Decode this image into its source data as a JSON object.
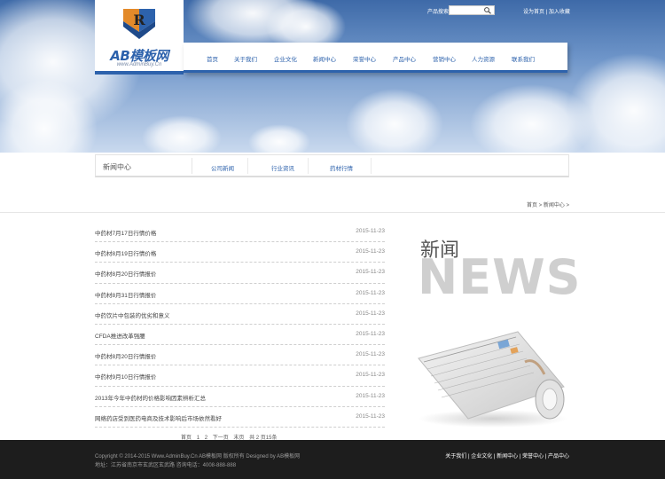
{
  "header": {
    "logo_letter": "R",
    "logo_text": "AB模板网",
    "logo_url": "www.AdminBuy.Cn",
    "search_label": "产品搜索",
    "search_placeholder": "",
    "top_links": [
      "设为首页",
      "加入收藏"
    ],
    "nav": [
      "首页",
      "关于我们",
      "企业文化",
      "新闻中心",
      "荣誉中心",
      "产品中心",
      "营销中心",
      "人力资源",
      "联系我们"
    ]
  },
  "subnav": {
    "section_title": "新闻中心",
    "tabs": [
      "公司新闻",
      "行业资讯",
      "药材行情"
    ]
  },
  "breadcrumb": "首页 > 新闻中心 >",
  "news": [
    {
      "title": "中药材7月17日行情价格",
      "date": "2015-11-23"
    },
    {
      "title": "中药材8月19日行情价格",
      "date": "2015-11-23"
    },
    {
      "title": "中药材8月20日行情报价",
      "date": "2015-11-23"
    },
    {
      "title": "中药材8月31日行情报价",
      "date": "2015-11-23"
    },
    {
      "title": "中药饮片中包装的优劣和意义",
      "date": "2015-11-23"
    },
    {
      "title": "CFDA推进改革强腰",
      "date": "2015-11-23"
    },
    {
      "title": "中药材8月20日行情报价",
      "date": "2015-11-23"
    },
    {
      "title": "中药材9月10日行情报价",
      "date": "2015-11-23"
    },
    {
      "title": "2013年今年中药材的价格影响因素辨析汇总",
      "date": "2015-11-23"
    },
    {
      "title": "网络药店受到医药电商及技术影响后市场依然看好",
      "date": "2015-11-23"
    }
  ],
  "pager": {
    "text": "首页 1 2 下一页 末页 共 2 页15条",
    "items": [
      "首页",
      "1",
      "2",
      "下一页",
      "末页"
    ],
    "summary": "共 2 页15条"
  },
  "side": {
    "title_cn": "新闻",
    "title_en": "NEWS"
  },
  "footer": {
    "copyright": "Copyright © 2014-2015 Www.AdminBuy.Cn AB模板网 版权所有 Designed by AB模板网",
    "address": "地址：江苏省南京市玄武区玄武路 咨询电话：4008-888-888",
    "links": [
      "关于我们",
      "企业文化",
      "新闻中心",
      "荣誉中心",
      "产品中心"
    ]
  },
  "colors": {
    "brand_blue": "#2d62ac",
    "footer_bg": "#1d1d1d",
    "logo_orange": "#e38a2a"
  },
  "icons": {
    "search": "search-icon",
    "logo": "logo-mark-icon",
    "newspaper": "newspaper-illustration"
  }
}
